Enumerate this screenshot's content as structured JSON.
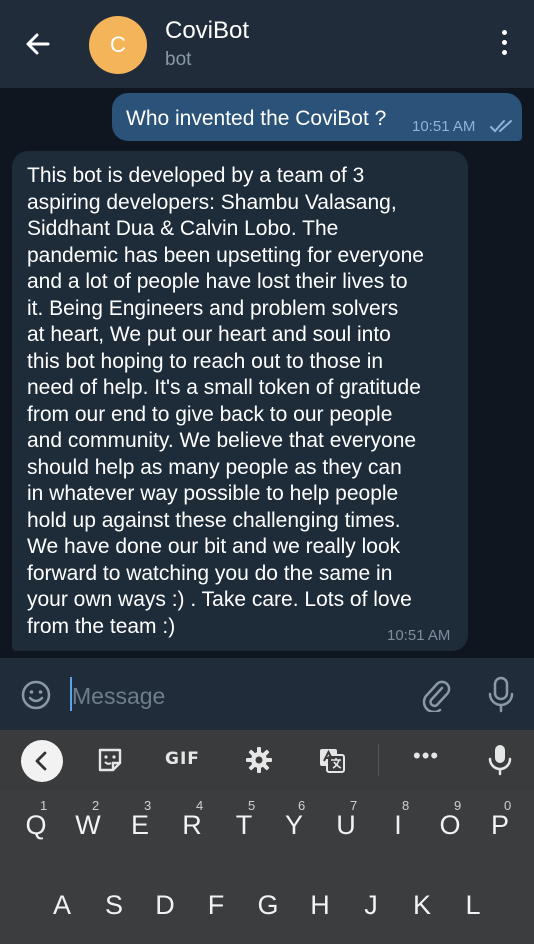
{
  "header": {
    "avatar_letter": "C",
    "title": "CoviBot",
    "subtitle": "bot",
    "avatar_color": "#f3b45a",
    "back_icon": "arrow-left-icon",
    "menu_icon": "more-vert-icon"
  },
  "messages": {
    "outgoing": {
      "text": "Who invented the CoviBot ?",
      "time": "10:51 AM",
      "status_icon": "double-check-icon"
    },
    "incoming": {
      "text": "This bot is developed by a team of 3\naspiring developers: Shambu Valasang,\nSiddhant Dua & Calvin Lobo. The\npandemic has been upsetting for everyone\nand a lot of people have lost their lives to\nit. Being Engineers and problem solvers\nat heart, We put our heart and soul into\nthis bot hoping to reach out to those in\nneed of help. It's a small token of gratitude\nfrom our end to give back to our people\nand community. We believe that everyone\nshould help as many people as they can\nin whatever way possible to help people\nhold up against these challenging times.\nWe have done our bit and we really look\nforward to watching you do the same in\nyour own ways :) . Take care. Lots of love\nfrom the team :)",
      "time": "10:51 AM"
    }
  },
  "composer": {
    "placeholder": "Message",
    "emoji_icon": "emoji-icon",
    "attach_icon": "paperclip-icon",
    "mic_icon": "microphone-icon"
  },
  "keyboard": {
    "toolbar": {
      "gif_label": "GIF",
      "dots_label": "•••"
    },
    "row1": [
      {
        "letter": "Q",
        "num": "1"
      },
      {
        "letter": "W",
        "num": "2"
      },
      {
        "letter": "E",
        "num": "3"
      },
      {
        "letter": "R",
        "num": "4"
      },
      {
        "letter": "T",
        "num": "5"
      },
      {
        "letter": "Y",
        "num": "6"
      },
      {
        "letter": "U",
        "num": "7"
      },
      {
        "letter": "I",
        "num": "8"
      },
      {
        "letter": "O",
        "num": "9"
      },
      {
        "letter": "P",
        "num": "0"
      }
    ],
    "row2": [
      "A",
      "S",
      "D",
      "F",
      "G",
      "H",
      "J",
      "K",
      "L"
    ]
  },
  "colors": {
    "background": "#0f1620",
    "header": "#202c39",
    "outgoing_bubble": "#2b5278",
    "incoming_bubble": "#1e2c3a",
    "accent": "#5aa4ec"
  }
}
